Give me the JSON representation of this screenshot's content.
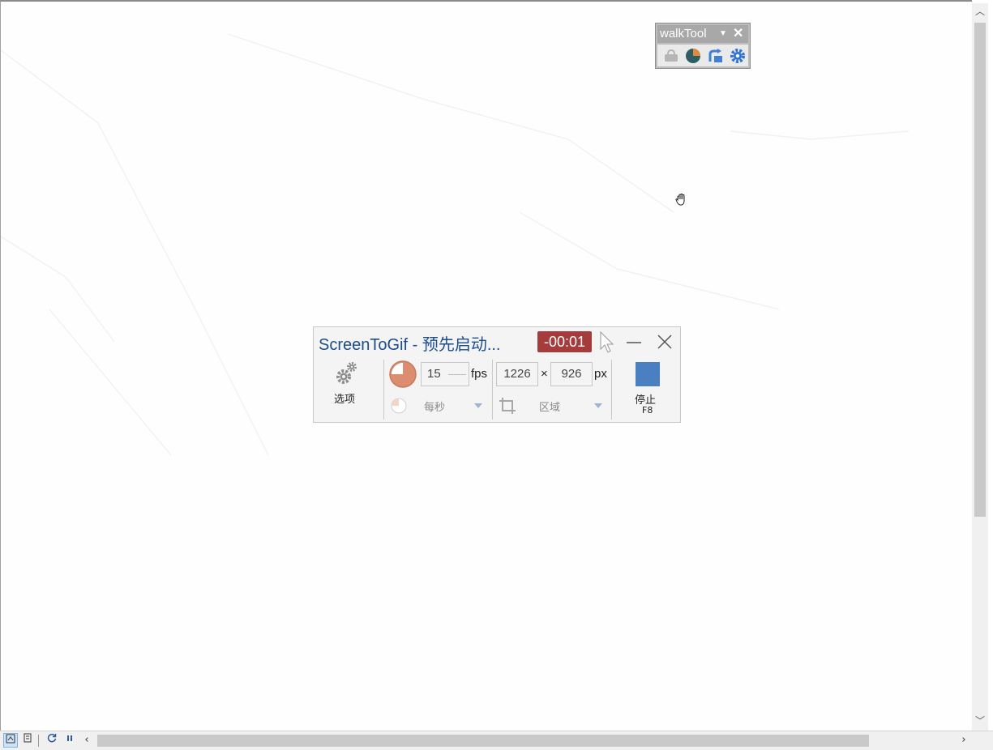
{
  "walktool": {
    "title": "walkTool",
    "dropdown_icon": "dropdown-arrow-icon",
    "close_icon": "close-icon",
    "tools": [
      "bag-icon",
      "pie-chart-icon",
      "refresh-doc-icon",
      "gear-icon"
    ]
  },
  "recorder": {
    "title": "ScreenToGif - 预先启动...",
    "timer": "-00:01",
    "options_label": "选项",
    "fps_value": "15",
    "fps_unit": "fps",
    "frequency_label": "每秒",
    "width_value": "1226",
    "times_sign": "×",
    "height_value": "926",
    "px_unit": "px",
    "region_label": "区域",
    "stop_label": "停止",
    "stop_shortcut": "F8",
    "timer_color": "#a53b3b",
    "stop_color": "#4a7fc1"
  },
  "bottombar": {
    "buttons": [
      "data-view-icon",
      "layout-view-icon",
      "refresh-icon",
      "pause-icon",
      "scroll-left-icon",
      "scroll-right-icon"
    ]
  },
  "scrollbar": {
    "up_icon": "scroll-up-icon",
    "down_icon": "scroll-down-icon"
  }
}
